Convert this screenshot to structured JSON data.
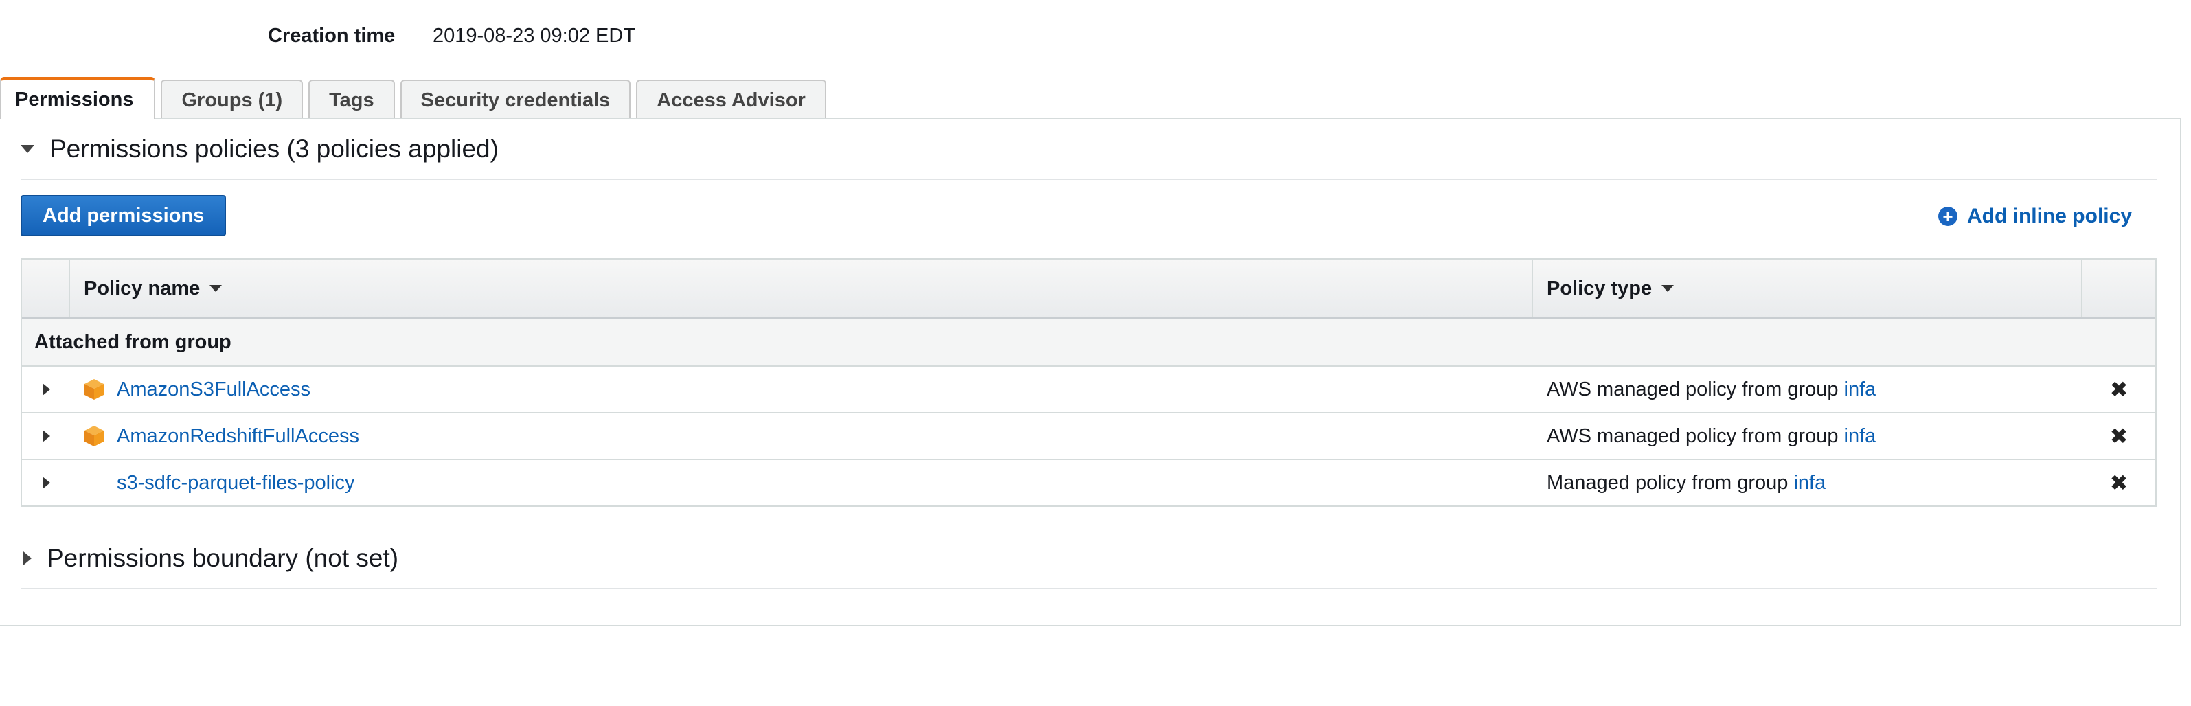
{
  "summary": {
    "creation_time_label": "Creation time",
    "creation_time_value": "2019-08-23 09:02 EDT"
  },
  "tabs": [
    {
      "label": "Permissions",
      "active": true
    },
    {
      "label": "Groups (1)",
      "active": false
    },
    {
      "label": "Tags",
      "active": false
    },
    {
      "label": "Security credentials",
      "active": false
    },
    {
      "label": "Access Advisor",
      "active": false
    }
  ],
  "permissions_policies": {
    "title": "Permissions policies (3 policies applied)",
    "add_permissions_label": "Add permissions",
    "add_inline_policy_label": "Add inline policy",
    "columns": {
      "policy_name": "Policy name",
      "policy_type": "Policy type"
    },
    "group_label": "Attached from group",
    "rows": [
      {
        "name": "AmazonS3FullAccess",
        "type_prefix": "AWS managed policy from group",
        "group": "infa",
        "icon": "aws-cube-icon"
      },
      {
        "name": "AmazonRedshiftFullAccess",
        "type_prefix": "AWS managed policy from group",
        "group": "infa",
        "icon": "aws-cube-icon"
      },
      {
        "name": "s3-sdfc-parquet-files-policy",
        "type_prefix": "Managed policy from group",
        "group": "infa",
        "icon": ""
      }
    ],
    "remove_symbol": "✖"
  },
  "permissions_boundary": {
    "title": "Permissions boundary (not set)"
  },
  "colors": {
    "accent_tab": "#ec7211",
    "link": "#0b5fb3",
    "primary_button": "#1a66c2",
    "cube": "#f39c1f"
  }
}
